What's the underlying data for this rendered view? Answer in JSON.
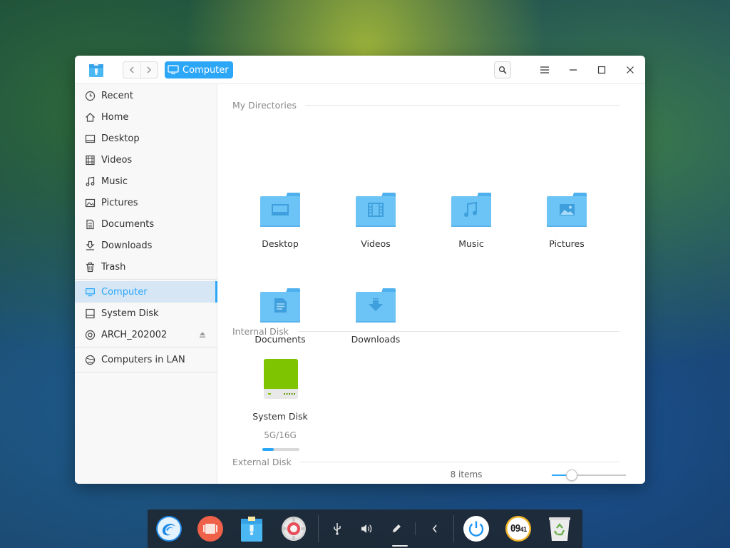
{
  "window": {
    "breadcrumb": "Computer"
  },
  "sidebar": {
    "items": [
      {
        "label": "Recent",
        "icon": "clock-icon"
      },
      {
        "label": "Home",
        "icon": "home-icon"
      },
      {
        "label": "Desktop",
        "icon": "desktop-icon"
      },
      {
        "label": "Videos",
        "icon": "film-icon"
      },
      {
        "label": "Music",
        "icon": "music-note-icon"
      },
      {
        "label": "Pictures",
        "icon": "picture-icon"
      },
      {
        "label": "Documents",
        "icon": "document-icon"
      },
      {
        "label": "Downloads",
        "icon": "download-icon"
      },
      {
        "label": "Trash",
        "icon": "trash-icon"
      },
      {
        "label": "Computer",
        "icon": "computer-icon",
        "active": true
      },
      {
        "label": "System Disk",
        "icon": "disk-icon"
      },
      {
        "label": "ARCH_202002",
        "icon": "optical-disc-icon"
      },
      {
        "label": "Computers in LAN",
        "icon": "network-icon"
      }
    ]
  },
  "main": {
    "sections": {
      "my_directories": "My Directories",
      "internal_disk": "Internal Disk",
      "external_disk": "External Disk"
    },
    "directories": [
      {
        "label": "Desktop",
        "icon": "desktop-folder-icon"
      },
      {
        "label": "Videos",
        "icon": "videos-folder-icon"
      },
      {
        "label": "Music",
        "icon": "music-folder-icon"
      },
      {
        "label": "Pictures",
        "icon": "pictures-folder-icon"
      },
      {
        "label": "Documents",
        "icon": "documents-folder-icon"
      },
      {
        "label": "Downloads",
        "icon": "downloads-folder-icon"
      }
    ],
    "disk": {
      "label": "System Disk",
      "size": "5G/16G",
      "usage_fraction": 0.31
    }
  },
  "status": {
    "items": "8 items",
    "zoom_fraction": 0.27
  },
  "colors": {
    "accent": "#2ca7f8",
    "folder": "#6cc3f5",
    "folder_tab": "#4fb0ee",
    "disk_green": "#7ec400"
  },
  "dock": {
    "apps": [
      "launcher-icon",
      "multitasking-icon",
      "file-manager-icon",
      "settings-icon"
    ],
    "tray": [
      "usb-icon",
      "volume-icon",
      "pen-icon",
      "collapse-arrow-icon"
    ],
    "clock": {
      "hours": "09",
      "minutes": "41"
    },
    "system": [
      "power-icon",
      "trash-can-icon"
    ]
  }
}
